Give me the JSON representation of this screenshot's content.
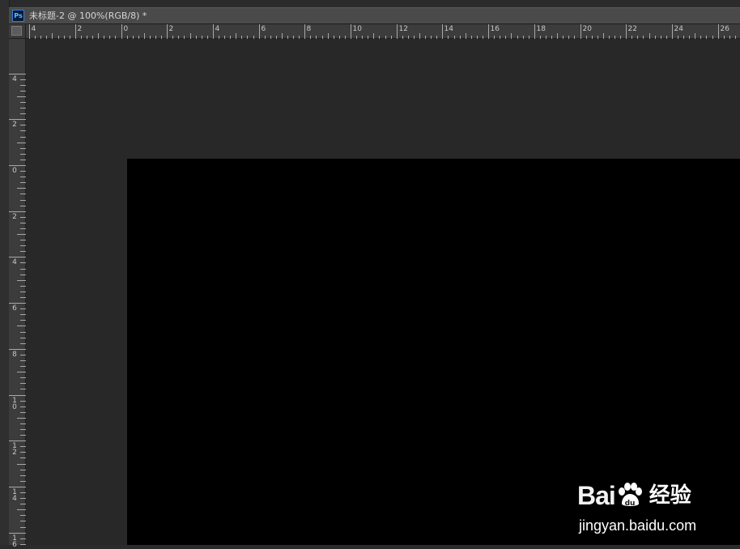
{
  "app": {
    "icon_label": "Ps"
  },
  "document": {
    "title": "未标题-2 @ 100%(RGB/8) *"
  },
  "rulers": {
    "horizontal_labels": [
      "4",
      "2",
      "0",
      "2",
      "4",
      "6",
      "8",
      "10",
      "12",
      "14",
      "16",
      "18",
      "20",
      "22",
      "24",
      "26"
    ],
    "vertical_labels": [
      "4",
      "2",
      "0",
      "2",
      "4",
      "6",
      "8",
      "10",
      "12",
      "14",
      "16"
    ]
  },
  "canvas": {
    "background": "#000000",
    "stroke_color": "#ffffff"
  },
  "watermark": {
    "brand_left": "Bai",
    "brand_right": "du",
    "product": "经验",
    "url": "jingyan.baidu.com"
  }
}
